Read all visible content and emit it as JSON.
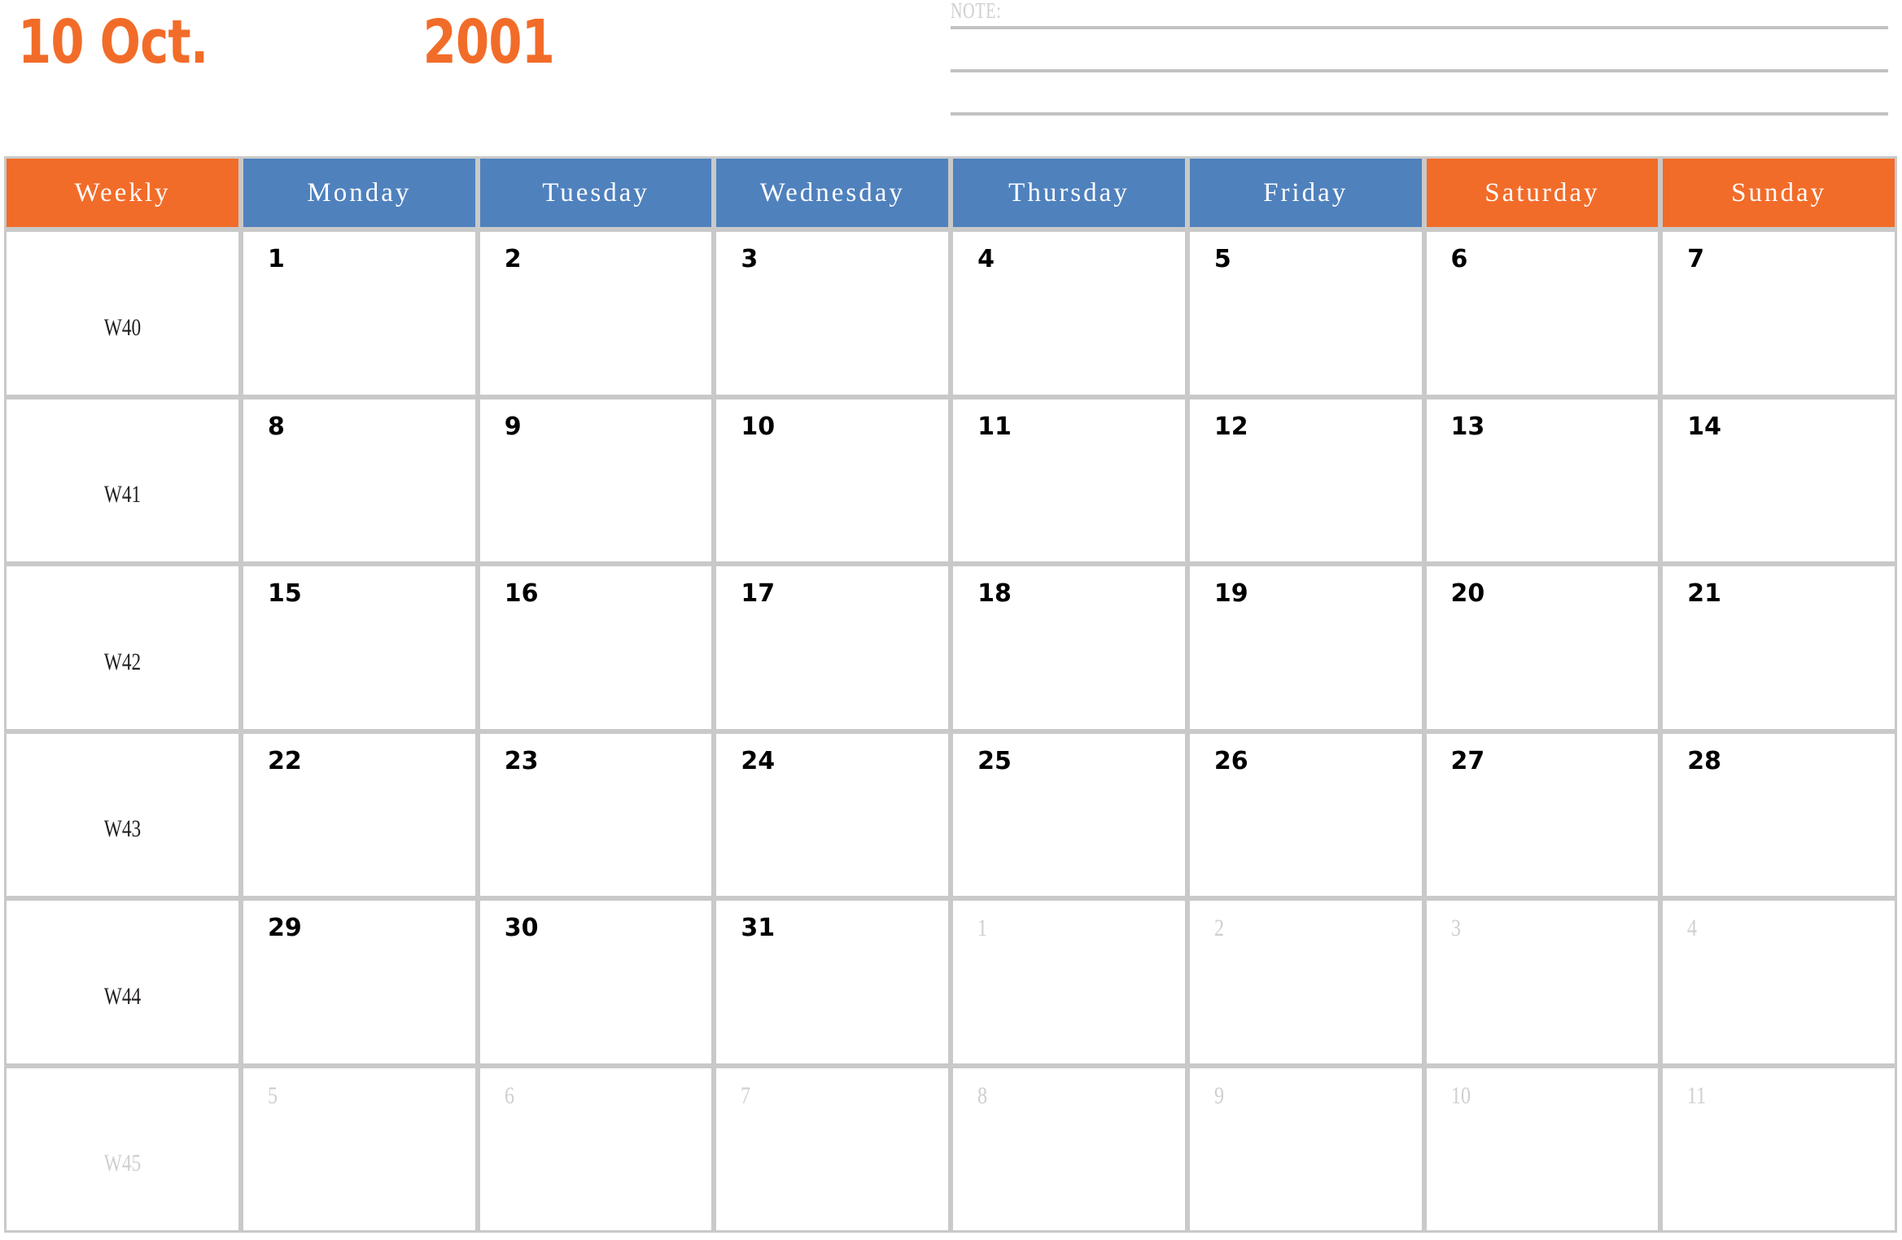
{
  "title": {
    "month_day": "10 Oct.",
    "year": "2001"
  },
  "note": {
    "label": "NOTE:",
    "lines": [
      "",
      "",
      ""
    ]
  },
  "colors": {
    "accent_orange": "#F26C29",
    "accent_blue": "#4F81BD",
    "grid_gray": "#c9c9c9",
    "muted_text": "#cfcfcf",
    "date_text": "#000000"
  },
  "table": {
    "headers": [
      {
        "label": "Weekly",
        "kind": "weekly"
      },
      {
        "label": "Monday",
        "kind": "weekday"
      },
      {
        "label": "Tuesday",
        "kind": "weekday"
      },
      {
        "label": "Wednesday",
        "kind": "weekday"
      },
      {
        "label": "Thursday",
        "kind": "weekday"
      },
      {
        "label": "Friday",
        "kind": "weekday"
      },
      {
        "label": "Saturday",
        "kind": "weekend"
      },
      {
        "label": "Sunday",
        "kind": "weekend"
      }
    ],
    "rows": [
      {
        "week": "W40",
        "week_muted": false,
        "days": [
          {
            "n": "1",
            "out": false
          },
          {
            "n": "2",
            "out": false
          },
          {
            "n": "3",
            "out": false
          },
          {
            "n": "4",
            "out": false
          },
          {
            "n": "5",
            "out": false
          },
          {
            "n": "6",
            "out": false
          },
          {
            "n": "7",
            "out": false
          }
        ]
      },
      {
        "week": "W41",
        "week_muted": false,
        "days": [
          {
            "n": "8",
            "out": false
          },
          {
            "n": "9",
            "out": false
          },
          {
            "n": "10",
            "out": false
          },
          {
            "n": "11",
            "out": false
          },
          {
            "n": "12",
            "out": false
          },
          {
            "n": "13",
            "out": false
          },
          {
            "n": "14",
            "out": false
          }
        ]
      },
      {
        "week": "W42",
        "week_muted": false,
        "days": [
          {
            "n": "15",
            "out": false
          },
          {
            "n": "16",
            "out": false
          },
          {
            "n": "17",
            "out": false
          },
          {
            "n": "18",
            "out": false
          },
          {
            "n": "19",
            "out": false
          },
          {
            "n": "20",
            "out": false
          },
          {
            "n": "21",
            "out": false
          }
        ]
      },
      {
        "week": "W43",
        "week_muted": false,
        "days": [
          {
            "n": "22",
            "out": false
          },
          {
            "n": "23",
            "out": false
          },
          {
            "n": "24",
            "out": false
          },
          {
            "n": "25",
            "out": false
          },
          {
            "n": "26",
            "out": false
          },
          {
            "n": "27",
            "out": false
          },
          {
            "n": "28",
            "out": false
          }
        ]
      },
      {
        "week": "W44",
        "week_muted": false,
        "days": [
          {
            "n": "29",
            "out": false
          },
          {
            "n": "30",
            "out": false
          },
          {
            "n": "31",
            "out": false
          },
          {
            "n": "1",
            "out": true
          },
          {
            "n": "2",
            "out": true
          },
          {
            "n": "3",
            "out": true
          },
          {
            "n": "4",
            "out": true
          }
        ]
      },
      {
        "week": "W45",
        "week_muted": true,
        "days": [
          {
            "n": "5",
            "out": true
          },
          {
            "n": "6",
            "out": true
          },
          {
            "n": "7",
            "out": true
          },
          {
            "n": "8",
            "out": true
          },
          {
            "n": "9",
            "out": true
          },
          {
            "n": "10",
            "out": true
          },
          {
            "n": "11",
            "out": true
          }
        ]
      }
    ]
  }
}
